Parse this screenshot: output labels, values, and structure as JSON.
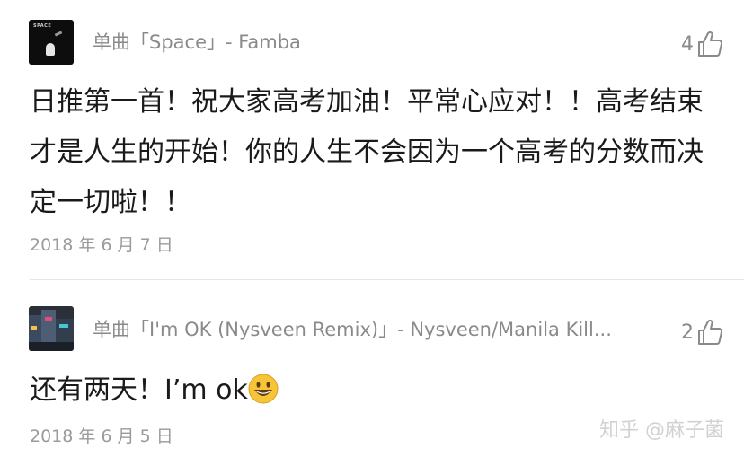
{
  "posts": [
    {
      "song": "单曲「Space」- Famba",
      "likes": "4",
      "comment": "日推第一首！祝大家高考加油！平常心应对！！高考结束才是人生的开始！你的人生不会因为一个高考的分数而决定一切啦！！",
      "date": "2018 年 6 月 7 日",
      "cover_text": "SPACE"
    },
    {
      "song": "单曲「I'm OK (Nysveen Remix)」- Nysveen/Manila Kill...",
      "likes": "2",
      "comment": "还有两天！I’m ok",
      "emoji": "smiling-face",
      "date": "2018 年 6 月 5 日"
    }
  ],
  "watermark": "知乎 @麻子菌",
  "icons": {
    "like": "thumbs-up-icon",
    "emoji": "grinning-face-icon"
  },
  "colors": {
    "secondary_text": "#8a8a8a",
    "body_text": "#1a1a1a",
    "divider": "#e5e5e5",
    "emoji_yellow": "#f7c437"
  }
}
